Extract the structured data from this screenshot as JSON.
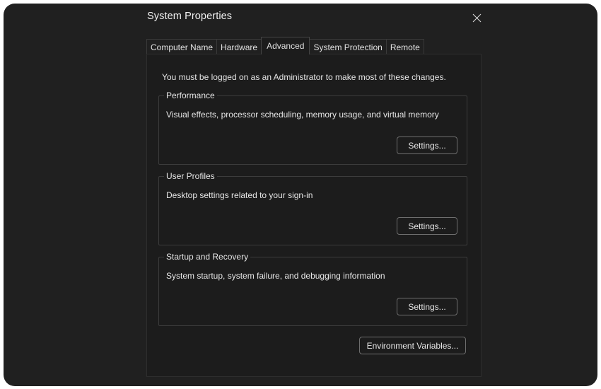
{
  "window": {
    "title": "System Properties",
    "close_icon": "close-icon"
  },
  "tabs": [
    {
      "label": "Computer Name",
      "active": false
    },
    {
      "label": "Hardware",
      "active": false
    },
    {
      "label": "Advanced",
      "active": true
    },
    {
      "label": "System Protection",
      "active": false
    },
    {
      "label": "Remote",
      "active": false
    }
  ],
  "advanced": {
    "notice": "You must be logged on as an Administrator to make most of these changes.",
    "groups": [
      {
        "label": "Performance",
        "description": "Visual effects, processor scheduling, memory usage, and virtual memory",
        "button": "Settings..."
      },
      {
        "label": "User Profiles",
        "description": "Desktop settings related to your sign-in",
        "button": "Settings..."
      },
      {
        "label": "Startup and Recovery",
        "description": "System startup, system failure, and debugging information",
        "button": "Settings..."
      }
    ],
    "env_button": "Environment Variables..."
  },
  "colors": {
    "background": "#202020",
    "panel": "#1c1c1c",
    "text": "#e6e6e6",
    "border": "#3c3c3c"
  }
}
